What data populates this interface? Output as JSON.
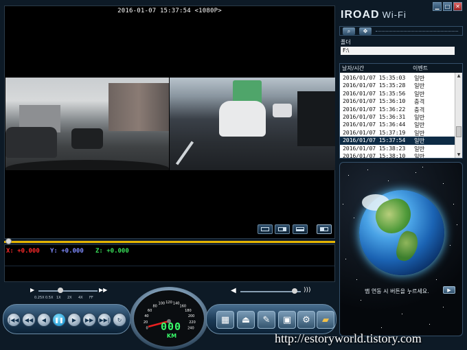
{
  "video": {
    "timestamp": "2016-01-07 15:37:54 <1080P>"
  },
  "gsensor": {
    "x_label": "X: +0.000",
    "y_label": "Y: +0.000",
    "z_label": "Z: +0.000",
    "colors": {
      "x": "#ff2a2a",
      "y": "#7f8cff",
      "z": "#39e05a"
    }
  },
  "playback_speed": {
    "labels": [
      "0.25X",
      "0.5X",
      "1X",
      "2X",
      "4X",
      "FF"
    ],
    "selected": "1X"
  },
  "seek": {
    "progress": 0.0
  },
  "volume": {
    "level": 0.9
  },
  "speedometer": {
    "readout": "000",
    "unit": "KM",
    "ticks": [
      "0",
      "20",
      "40",
      "60",
      "80",
      "100",
      "120",
      "140",
      "160",
      "180",
      "200",
      "220",
      "240"
    ]
  },
  "app": {
    "brand": "IROAD",
    "brand_suffix": "Wi-Fi"
  },
  "window_buttons": {
    "minimize": "▁",
    "maximize": "□",
    "close": "✕"
  },
  "folder": {
    "label": "폴더",
    "path": "F:\\"
  },
  "file_list": {
    "col_datetime": "날자/시간",
    "col_event": "이벤트",
    "rows": [
      {
        "datetime": "2016/01/07 15:35:03",
        "event": "일반"
      },
      {
        "datetime": "2016/01/07 15:35:28",
        "event": "일반"
      },
      {
        "datetime": "2016/01/07 15:35:56",
        "event": "일반"
      },
      {
        "datetime": "2016/01/07 15:36:10",
        "event": "충격"
      },
      {
        "datetime": "2016/01/07 15:36:22",
        "event": "충격"
      },
      {
        "datetime": "2016/01/07 15:36:31",
        "event": "일반"
      },
      {
        "datetime": "2016/01/07 15:36:44",
        "event": "일반"
      },
      {
        "datetime": "2016/01/07 15:37:19",
        "event": "일반"
      },
      {
        "datetime": "2016/01/07 15:37:54",
        "event": "일반"
      },
      {
        "datetime": "2016/01/07 15:38:23",
        "event": "일반"
      },
      {
        "datetime": "2016/01/07 15:38:10",
        "event": "일반"
      }
    ],
    "selected_index": 8
  },
  "map": {
    "message": "맵 연동 시 버튼을 누르세요."
  },
  "watermark": "http://estoryworld.tistory.com"
}
